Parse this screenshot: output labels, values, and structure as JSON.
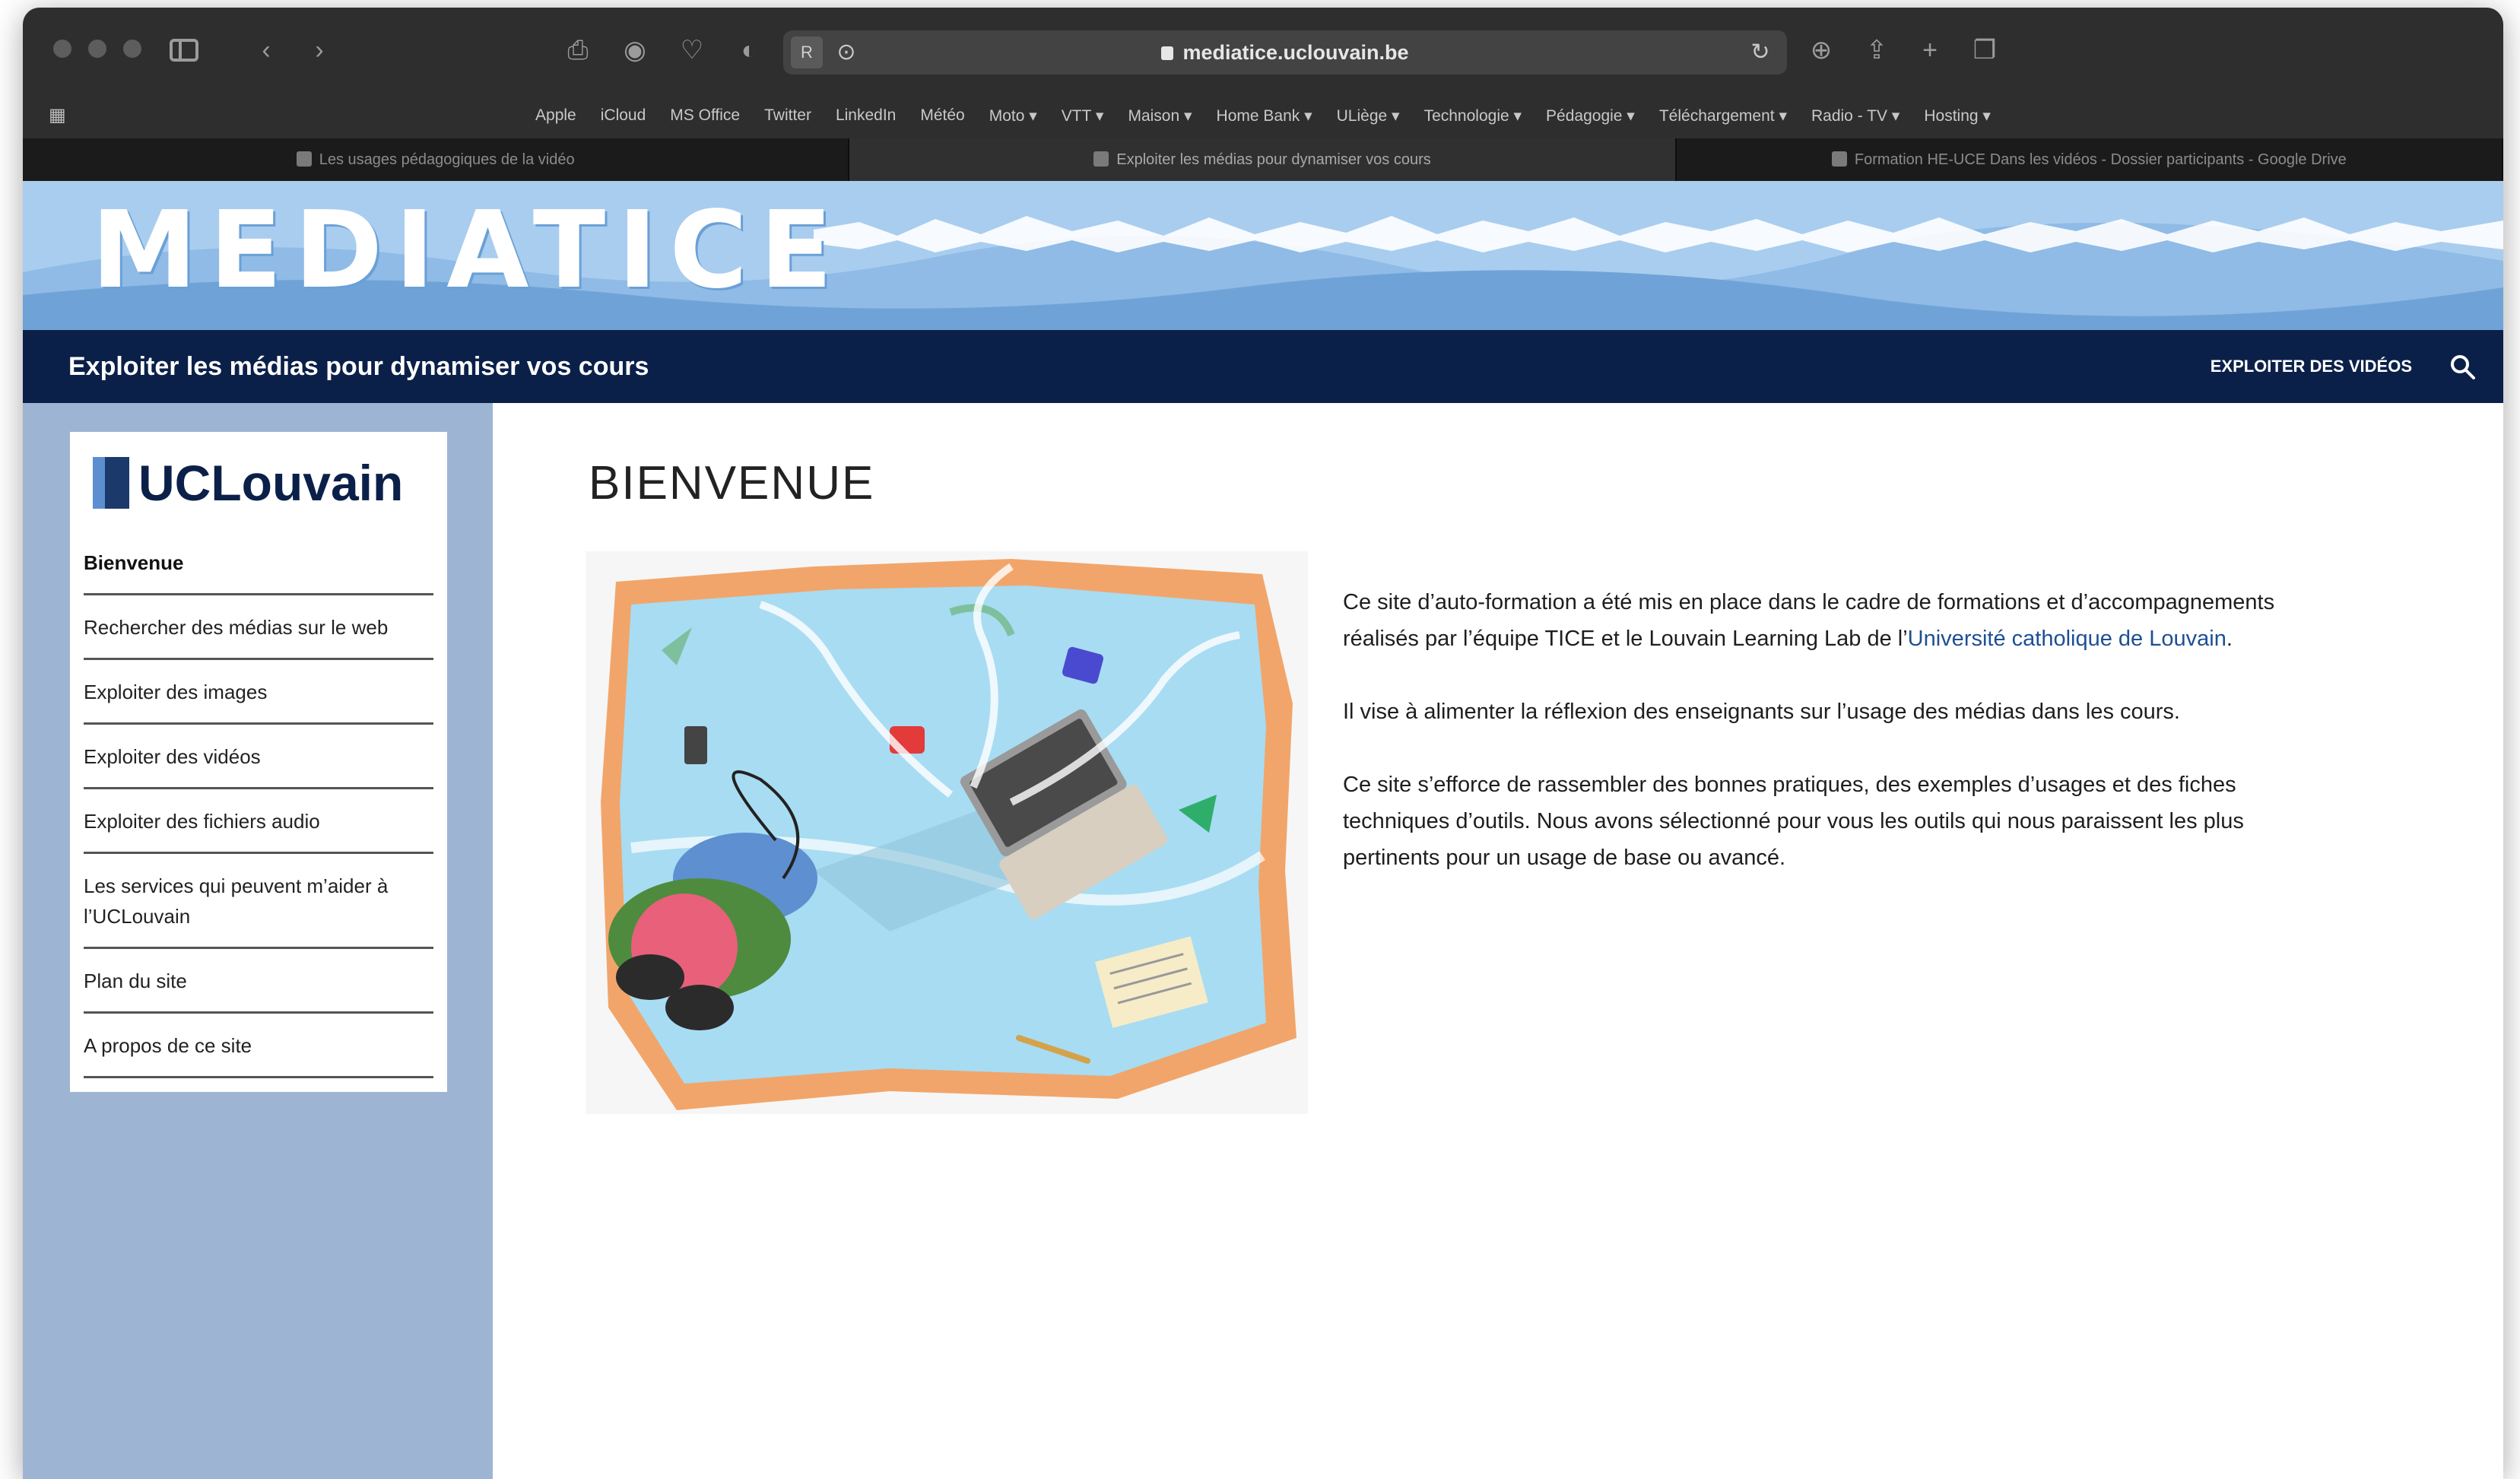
{
  "browser": {
    "url": "mediatice.uclouvain.be",
    "reader_icon": "reader-mode-icon",
    "favorites": [
      "Apple",
      "iCloud",
      "MS Office",
      "Twitter",
      "LinkedIn",
      "Météo",
      "Moto ▾",
      "VTT ▾",
      "Maison ▾",
      "Home Bank ▾",
      "ULiège ▾",
      "Technologie ▾",
      "Pédagogie ▾",
      "Téléchargement ▾",
      "Radio - TV ▾",
      "Hosting ▾"
    ],
    "tabs": [
      "Les usages pédagogiques de la vidéo",
      "Exploiter les médias pour dynamiser vos cours",
      "Formation HE-UCE Dans les vidéos - Dossier participants - Google Drive"
    ],
    "active_tab": 1
  },
  "banner": {
    "logo": "MEDIATICE"
  },
  "site": {
    "title": "Exploiter les médias pour dynamiser vos cours",
    "nav_link": "EXPLOITER DES VIDÉOS"
  },
  "sidebar": {
    "brand": "UCLouvain",
    "items": [
      {
        "label": "Bienvenue",
        "current": true
      },
      {
        "label": "Rechercher des médias sur le web"
      },
      {
        "label": "Exploiter des images"
      },
      {
        "label": "Exploiter des vidéos"
      },
      {
        "label": "Exploiter des fichiers audio"
      },
      {
        "label": "Les services qui peuvent m’aider à l’UCLouvain"
      },
      {
        "label": "Plan du site"
      },
      {
        "label": "A propos de ce site"
      }
    ]
  },
  "main": {
    "title": "BIENVENUE",
    "p1_text": "Ce site d’auto-formation a été mis en place dans le cadre de formations et d’accompagnements réalisés par l’équipe TICE et le Louvain Learning Lab de l’",
    "p1_link": "Université catholique de Louvain",
    "p1_end": ".",
    "p2": "Il vise à alimenter la réflexion des enseignants sur l’usage des médias dans les cours.",
    "p3": "Ce site s’efforce de rassembler des bonnes pratiques, des exemples d’usages et des fiches techniques d’outils. Nous avons sélectionné pour vous les outils qui nous paraissent les plus pertinents pour un usage de base ou avancé."
  },
  "colors": {
    "site_bar": "#0b2049",
    "sidebar_bg": "#9db5d3",
    "link": "#1e4f94",
    "banner": "#a9cdef"
  }
}
